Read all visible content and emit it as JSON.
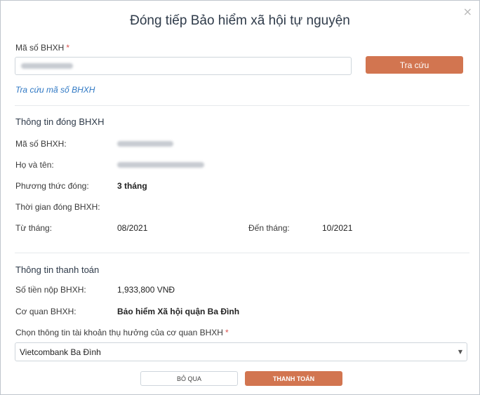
{
  "dialog": {
    "title": "Đóng tiếp Bảo hiểm xã hội tự nguyện",
    "close_icon": "×"
  },
  "lookup": {
    "field_label": "Mã số BHXH",
    "required_mark": "*",
    "search_button": "Tra cứu",
    "lookup_link": "Tra cứu mã số BHXH"
  },
  "payment_info": {
    "section_title": "Thông tin đóng BHXH",
    "code_label": "Mã số BHXH:",
    "name_label": "Họ và tên:",
    "method_label": "Phương thức đóng:",
    "method_value": "3 tháng",
    "period_label": "Thời gian đóng BHXH:",
    "from_label": "Từ tháng:",
    "from_value": "08/2021",
    "to_label": "Đến tháng:",
    "to_value": "10/2021"
  },
  "billing": {
    "section_title": "Thông tin thanh toán",
    "amount_label": "Số tiền nộp BHXH:",
    "amount_value": "1,933,800 VNĐ",
    "agency_label": "Cơ quan BHXH:",
    "agency_value": "Bảo hiểm Xã hội quận Ba Đình",
    "account_label": "Chọn thông tin tài khoản thụ hưởng của cơ quan BHXH",
    "account_required": "*",
    "account_selected": "Vietcombank Ba Đình",
    "caret_icon": "▼"
  },
  "footer": {
    "skip_button": "BỎ QUA",
    "pay_button": "THANH TOÁN"
  },
  "colors": {
    "accent": "#d27550",
    "link": "#2f78c4",
    "required": "#d9534f"
  }
}
